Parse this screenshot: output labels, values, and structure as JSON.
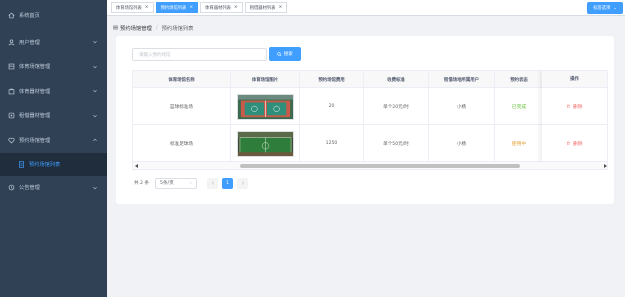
{
  "sidebar": {
    "items": [
      {
        "label": "系统首页",
        "icon": "home-icon"
      },
      {
        "label": "用户管理",
        "icon": "user-icon"
      },
      {
        "label": "体育场馆管理",
        "icon": "venue-icon"
      },
      {
        "label": "体育器材管理",
        "icon": "equipment-icon"
      },
      {
        "label": "租借器材管理",
        "icon": "rent-icon"
      },
      {
        "label": "预约场馆管理",
        "icon": "heart-icon"
      },
      {
        "label": "预约场馆列表",
        "icon": "doc-icon"
      },
      {
        "label": "公告管理",
        "icon": "bell-icon"
      }
    ]
  },
  "tags": [
    {
      "label": "体育场馆列表",
      "active": false
    },
    {
      "label": "预约场馆列表",
      "active": true
    },
    {
      "label": "体育器材列表",
      "active": false
    },
    {
      "label": "租借器材列表",
      "active": false
    }
  ],
  "tag_ops_label": "标签选项",
  "breadcrumb": {
    "parent": "预约场馆管理",
    "separator": "/",
    "current": "预约场馆列表"
  },
  "search": {
    "placeholder": "请输入预约场馆",
    "button_label": "搜索"
  },
  "table": {
    "columns": [
      "体育场馆名称",
      "体育场馆图片",
      "预约场馆费用",
      "收费标准",
      "租借场地所属用户",
      "预约状态",
      "操作"
    ],
    "rows": [
      {
        "name": "篮球标准场",
        "fee": "20",
        "standard": "单个20元/时",
        "user": "小杨",
        "status": "已完成",
        "status_color": "#67c23a",
        "action": "删除",
        "image": "basketball-court"
      },
      {
        "name": "标准足球场",
        "fee": "1250",
        "standard": "单个50元/时",
        "user": "小杨",
        "status": "使用中",
        "status_color": "#e6a23c",
        "action": "删除",
        "image": "football-field"
      }
    ]
  },
  "pager": {
    "total_text": "共 2 条",
    "page_size": "5条/页",
    "current_page": "1"
  },
  "colors": {
    "accent": "#409eff",
    "danger": "#f56c6c",
    "sidebar_bg": "#304156"
  }
}
